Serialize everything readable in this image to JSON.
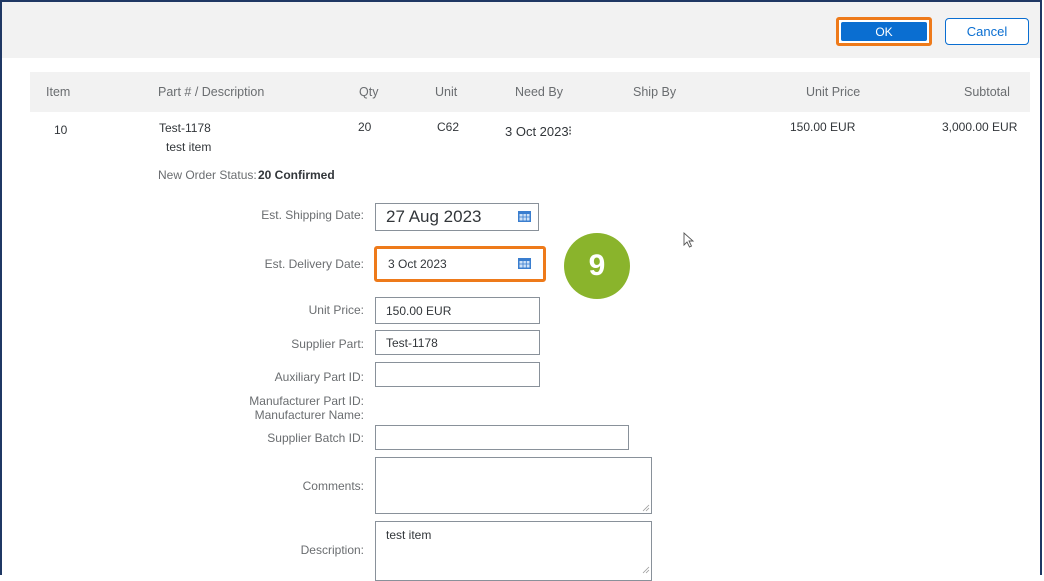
{
  "toolbar": {
    "ok_label": "OK",
    "cancel_label": "Cancel"
  },
  "table": {
    "headers": [
      "Item",
      "Part # / Description",
      "Qty",
      "Unit",
      "Need By",
      "Ship By",
      "Unit Price",
      "Subtotal"
    ],
    "row": {
      "item": "10",
      "part": "Test-1178",
      "description": "test item",
      "qty": "20",
      "unit": "C62",
      "need_by": "3 Oct 2023",
      "ship_by": "",
      "unit_price": "150.00 EUR",
      "subtotal": "3,000.00 EUR"
    }
  },
  "status": {
    "label": "New Order Status:",
    "value": "20 Confirmed"
  },
  "form": {
    "est_shipping_label": "Est. Shipping Date:",
    "est_shipping_value": "27 Aug 2023",
    "est_delivery_label": "Est. Delivery Date:",
    "est_delivery_value": "3 Oct 2023",
    "unit_price_label": "Unit Price:",
    "unit_price_value": "150.00 EUR",
    "supplier_part_label": "Supplier Part:",
    "supplier_part_value": "Test-1178",
    "aux_part_label": "Auxiliary Part ID:",
    "aux_part_value": "",
    "mfr_part_label": "Manufacturer Part ID:",
    "mfr_name_label": "Manufacturer Name:",
    "supplier_batch_label": "Supplier Batch ID:",
    "supplier_batch_value": "",
    "comments_label": "Comments:",
    "comments_value": "",
    "description_label": "Description:",
    "description_value": "test item"
  },
  "step_badge": "9",
  "colors": {
    "accent": "#0a6ed1",
    "highlight": "#ee7a1a",
    "badge": "#8ab42c"
  }
}
